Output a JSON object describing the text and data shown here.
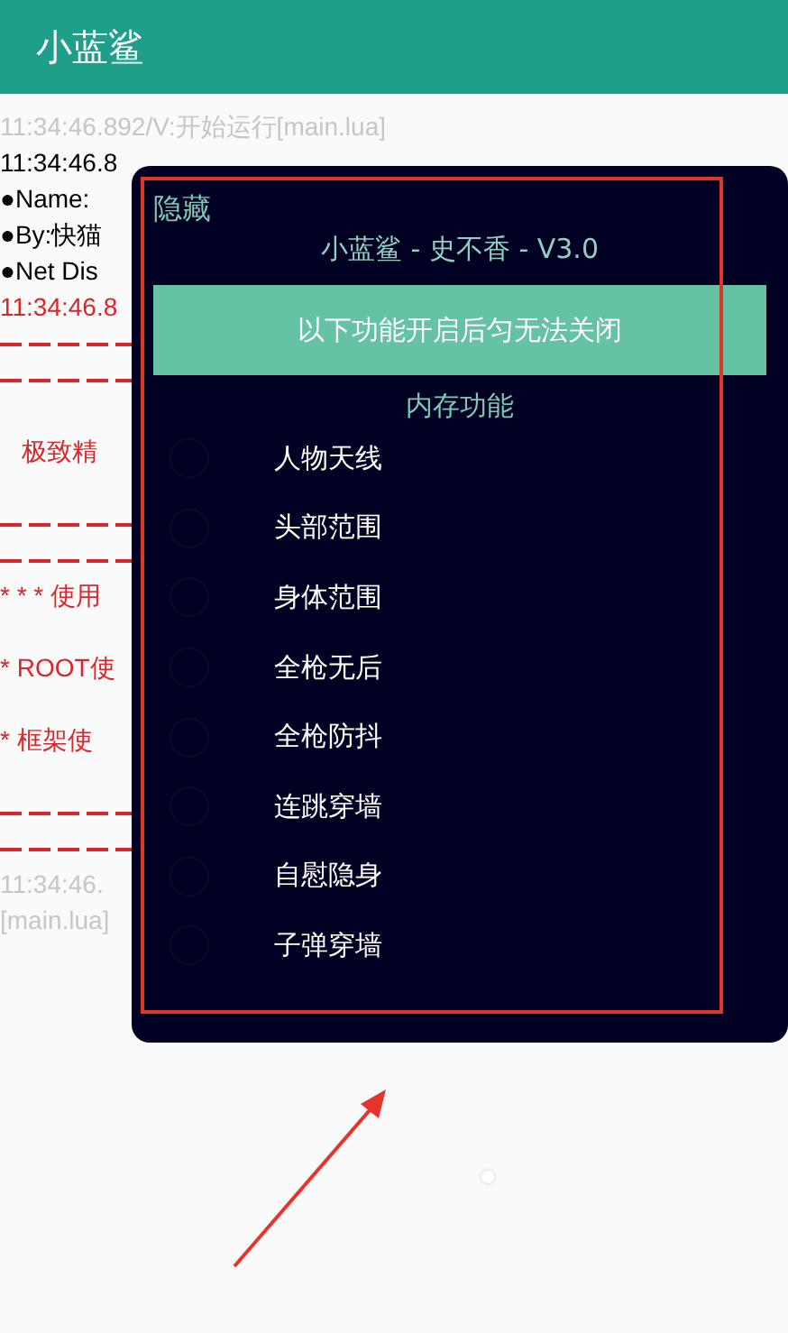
{
  "app_bar": {
    "title": "小蓝鲨"
  },
  "log": [
    {
      "kind": "text",
      "color": "#c6c6c6",
      "text": "11:34:46.892/V:开始运行[main.lua]"
    },
    {
      "kind": "text",
      "color": "#000000",
      "text": "11:34:46.8"
    },
    {
      "kind": "text",
      "color": "#000000",
      "text": "●Name:"
    },
    {
      "kind": "text",
      "color": "#000000",
      "text": "●By:快猫"
    },
    {
      "kind": "text",
      "color": "#000000",
      "text": "●Net Dis"
    },
    {
      "kind": "text",
      "color": "#d8262b",
      "text": "11:34:46.8"
    },
    {
      "kind": "rule",
      "color": "#d8262b"
    },
    {
      "kind": "rule",
      "color": "#d8262b"
    },
    {
      "kind": "gap"
    },
    {
      "kind": "indent",
      "color": "#d8262b",
      "text": "极致精"
    },
    {
      "kind": "gap"
    },
    {
      "kind": "rule",
      "color": "#d8262b"
    },
    {
      "kind": "rule",
      "color": "#d8262b"
    },
    {
      "kind": "text",
      "color": "#d8262b",
      "text": "* * * 使用"
    },
    {
      "kind": "gap"
    },
    {
      "kind": "text",
      "color": "#d8262b",
      "text": "* ROOT使"
    },
    {
      "kind": "gap"
    },
    {
      "kind": "text",
      "color": "#d8262b",
      "text": "* 框架使"
    },
    {
      "kind": "gap"
    },
    {
      "kind": "rule",
      "color": "#d8262b"
    },
    {
      "kind": "rule",
      "color": "#d8262b"
    },
    {
      "kind": "text",
      "color": "#c6c6c6",
      "text": "11:34:46."
    },
    {
      "kind": "text",
      "color": "#c6c6c6",
      "text": "[main.lua]"
    }
  ],
  "menu": {
    "hide": "隐藏",
    "title": "小蓝鲨 - 史不香 - V3.0",
    "banner": "以下功能开启后匀无法关闭",
    "section": "内存功能",
    "items": [
      {
        "label": "人物天线",
        "checked": false
      },
      {
        "label": "头部范围",
        "checked": false
      },
      {
        "label": "身体范围",
        "checked": false
      },
      {
        "label": "全枪无后",
        "checked": false
      },
      {
        "label": "全枪防抖",
        "checked": false
      },
      {
        "label": "连跳穿墙",
        "checked": false
      },
      {
        "label": "自慰隐身",
        "checked": false
      },
      {
        "label": "子弹穿墙",
        "checked": false
      }
    ]
  }
}
